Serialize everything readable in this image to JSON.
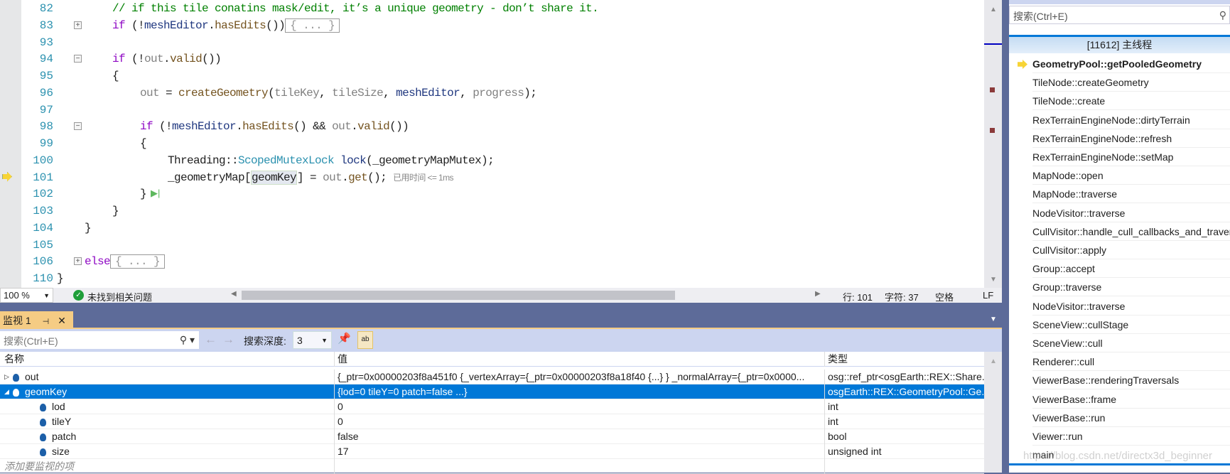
{
  "editor": {
    "lines": [
      {
        "n": "82",
        "html": "<span class='cm'>// if this tile conatins mask/edit, it’s a unique geometry - don’t share it.</span>",
        "indent": 2
      },
      {
        "n": "83",
        "html": "<span class='kw'>if</span> (!<span class='var'>meshEditor</span>.<span class='fn'>hasEdits</span>())<span class='collapsed'>{ ... }</span>",
        "indent": 2,
        "fold": "+"
      },
      {
        "n": "93",
        "html": "",
        "indent": 2
      },
      {
        "n": "94",
        "html": "<span class='kw'>if</span> (!<span class='par'>out</span>.<span class='fn'>valid</span>())",
        "indent": 2,
        "fold": "-"
      },
      {
        "n": "95",
        "html": "{",
        "indent": 2
      },
      {
        "n": "96",
        "html": "<span class='par'>out</span> = <span class='fn'>createGeometry</span>(<span class='par'>tileKey</span>, <span class='par'>tileSize</span>, <span class='var'>meshEditor</span>, <span class='par'>progress</span>);",
        "indent": 3
      },
      {
        "n": "97",
        "html": "",
        "indent": 3
      },
      {
        "n": "98",
        "html": "<span class='kw'>if</span> (!<span class='var'>meshEditor</span>.<span class='fn'>hasEdits</span>() &amp;&amp; <span class='par'>out</span>.<span class='fn'>valid</span>())",
        "indent": 3,
        "fold": "-"
      },
      {
        "n": "99",
        "html": "{",
        "indent": 3
      },
      {
        "n": "100",
        "html": "Threading::<span class='ty'>ScopedMutexLock</span> <span class='var'>lock</span>(_geometryMapMutex);",
        "indent": 4
      },
      {
        "n": "101",
        "html": "_geometryMap<span style='background:#e4e8f0;border:1px solid #cfe0c8'>geomKey</span> = <span class='par'>out</span>.<span class='fn'>get</span>(); <span class='hint'>已用时间 &lt;= 1ms</span>",
        "indent": 4
      },
      {
        "n": "102",
        "html": "}",
        "indent": 3
      },
      {
        "n": "103",
        "html": "}",
        "indent": 2
      },
      {
        "n": "104",
        "html": "}",
        "indent": 1
      },
      {
        "n": "105",
        "html": "",
        "indent": 1
      },
      {
        "n": "106",
        "html": "<span class='kw'>else</span><span class='collapsed'>{ ... }</span>",
        "indent": 1,
        "fold": "+"
      },
      {
        "n": "110",
        "html": "}",
        "indent": 0
      }
    ],
    "current_line": "101"
  },
  "status": {
    "zoom": "100 %",
    "issues": "未找到相关问题",
    "line": "行: 101",
    "char": "字符: 37",
    "spaces": "空格",
    "eol": "LF"
  },
  "watch": {
    "tab": "监视 1",
    "search_placeholder": "搜索(Ctrl+E)",
    "depth_label": "搜索深度:",
    "depth": "3",
    "headers": [
      "名称",
      "值",
      "类型"
    ],
    "rows": [
      {
        "name": "out",
        "value": "{_ptr=0x00000203f8a451f0 {_vertexArray={_ptr=0x00000203f8a18f40 {...} } _normalArray={_ptr=0x0000...",
        "type": "osg::ref_ptr<osgEarth::REX::Share...",
        "level": 0,
        "expand": "▷"
      },
      {
        "name": "geomKey",
        "value": "{lod=0 tileY=0 patch=false ...}",
        "type": "osgEarth::REX::GeometryPool::Ge...",
        "level": 0,
        "expand": "◢",
        "selected": true
      },
      {
        "name": "lod",
        "value": "0",
        "type": "int",
        "level": 1
      },
      {
        "name": "tileY",
        "value": "0",
        "type": "int",
        "level": 1
      },
      {
        "name": "patch",
        "value": "false",
        "type": "bool",
        "level": 1
      },
      {
        "name": "size",
        "value": "17",
        "type": "unsigned int",
        "level": 1
      }
    ],
    "add_placeholder": "添加要监视的项"
  },
  "callstack": {
    "search_placeholder": "搜索(Ctrl+E)",
    "thread": "[11612] 主线程",
    "frames": [
      "GeometryPool::getPooledGeometry",
      "TileNode::createGeometry",
      "TileNode::create",
      "RexTerrainEngineNode::dirtyTerrain",
      "RexTerrainEngineNode::refresh",
      "RexTerrainEngineNode::setMap",
      "MapNode::open",
      "MapNode::traverse",
      "NodeVisitor::traverse",
      "CullVisitor::handle_cull_callbacks_and_traverse",
      "CullVisitor::apply",
      "Group::accept",
      "Group::traverse",
      "NodeVisitor::traverse",
      "SceneView::cullStage",
      "SceneView::cull",
      "Renderer::cull",
      "ViewerBase::renderingTraversals",
      "ViewerBase::frame",
      "ViewerBase::run",
      "Viewer::run",
      "main"
    ],
    "watermark": "https://blog.csdn.net/directx3d_beginner"
  },
  "colors": {
    "accent": "#0078d7",
    "chrome": "#5d6b99",
    "tab_active": "#f5cc84",
    "toolbar": "#ccd5f0"
  }
}
